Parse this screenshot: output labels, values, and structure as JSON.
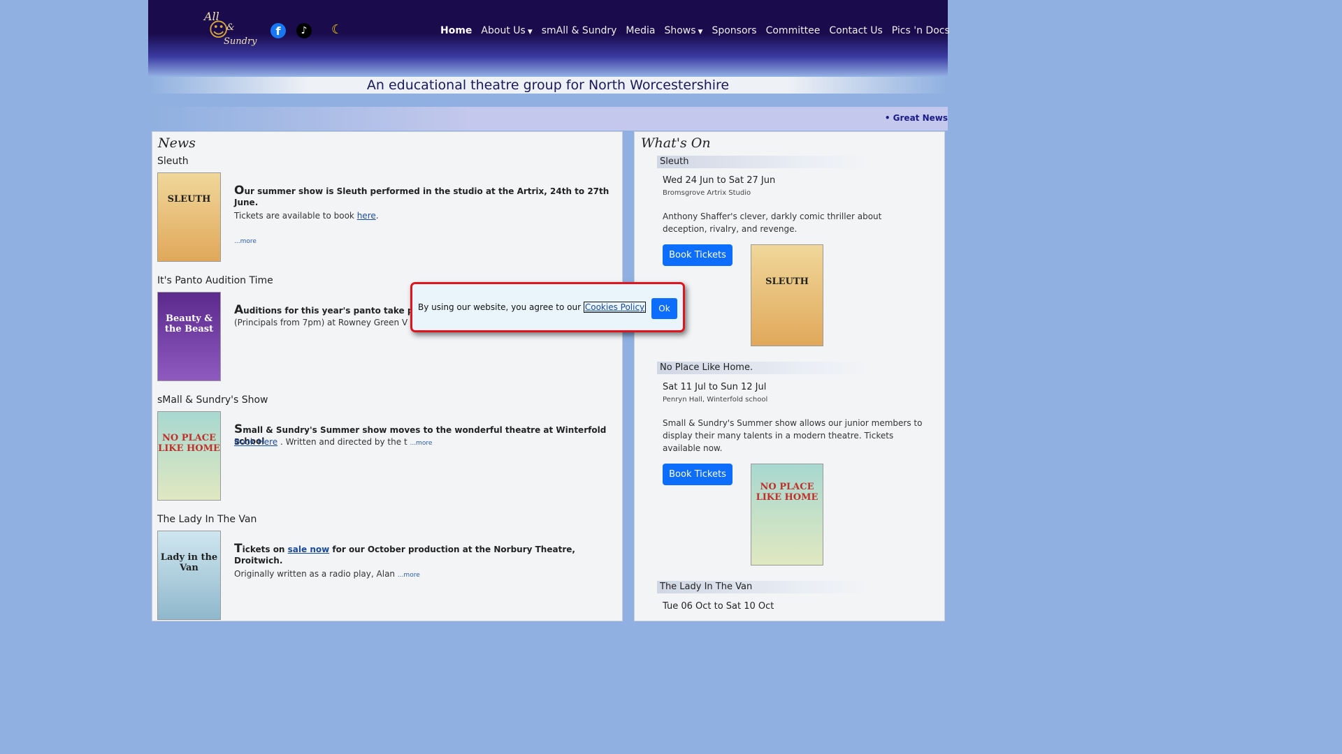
{
  "header": {
    "logo": {
      "line1": "All",
      "line2": "&",
      "line3": "Sundry"
    },
    "social": {
      "facebook": "f",
      "tiktok": "♪"
    },
    "theme_icon": "moon-icon",
    "nav": [
      {
        "label": "Home",
        "active": true,
        "dropdown": false
      },
      {
        "label": "About Us",
        "active": false,
        "dropdown": true
      },
      {
        "label": "smAll & Sundry",
        "active": false,
        "dropdown": false
      },
      {
        "label": "Media",
        "active": false,
        "dropdown": false
      },
      {
        "label": "Shows",
        "active": false,
        "dropdown": true
      },
      {
        "label": "Sponsors",
        "active": false,
        "dropdown": false
      },
      {
        "label": "Committee",
        "active": false,
        "dropdown": false
      },
      {
        "label": "Contact Us",
        "active": false,
        "dropdown": false
      },
      {
        "label": "Pics 'n Docs",
        "active": false,
        "dropdown": false
      }
    ]
  },
  "tagline": "An educational theatre group for North Worcestershire",
  "ticker": "• Great News",
  "news": {
    "title": "News",
    "items": [
      {
        "title": "Sleuth",
        "poster": "SLEUTH",
        "lead_cap": "O",
        "lead": "ur summer show is Sleuth performed in the studio at the Artrix, 24th to 27th June.",
        "body_pre": "Tickets are available to book ",
        "link": "here",
        "body_post": ".",
        "more": "...more"
      },
      {
        "title": "It's Panto Audition Time",
        "poster": "Beauty & the Beast",
        "lead_cap": "A",
        "lead": "uditions for this year's panto take pla",
        "body_pre": "(Principals from 7pm) at Rowney Green V",
        "body_post": "",
        "more": "...more"
      },
      {
        "title": "sMall & Sundry's Show",
        "poster": "NO PLACE LIKE HOME",
        "lead_cap": "S",
        "lead": "mall & Sundry's Summer show moves to the wonderful theatre at Winterfold school",
        "link": "Book Here",
        "body_post": " . Written and directed by the t ",
        "more": "...more"
      },
      {
        "title": "The Lady In The Van",
        "poster": "Lady in the Van",
        "lead_cap": "T",
        "lead_pre": "ickets on ",
        "lead_link": "sale now",
        "lead": " for our October production at the Norbury Theatre, Droitwich.",
        "body_pre": "Originally written as a radio play, Alan ",
        "more": "...more"
      }
    ]
  },
  "whats_on": {
    "title": "What's On",
    "events": [
      {
        "name": "Sleuth",
        "dates": "Wed 24 Jun to Sat 27 Jun",
        "venue": "Bromsgrove Artrix Studio",
        "desc": "Anthony Shaffer's clever, darkly comic thriller about deception, rivalry, and revenge.",
        "button": "Book Tickets",
        "poster": "SLEUTH"
      },
      {
        "name": "No Place Like Home.",
        "dates": "Sat 11 Jul to Sun 12 Jul",
        "venue": "Penryn Hall, Winterfold school",
        "desc": "Small & Sundry's Summer show allows our junior members to display their many talents in a modern theatre. Tickets available now.",
        "button": "Book Tickets",
        "poster": "NO PLACE LIKE HOME"
      },
      {
        "name": "The Lady In The Van",
        "dates": "Tue 06 Oct to Sat 10 Oct"
      }
    ]
  },
  "cookie": {
    "text": "By using our website, you agree to our ",
    "link": "Cookies Policy",
    "ok": "Ok"
  },
  "colors": {
    "header_bg": "#1a0b4d",
    "accent_button": "#0d6efd",
    "cookie_border": "#e0141e",
    "page_bg": "#8fb0e0"
  }
}
